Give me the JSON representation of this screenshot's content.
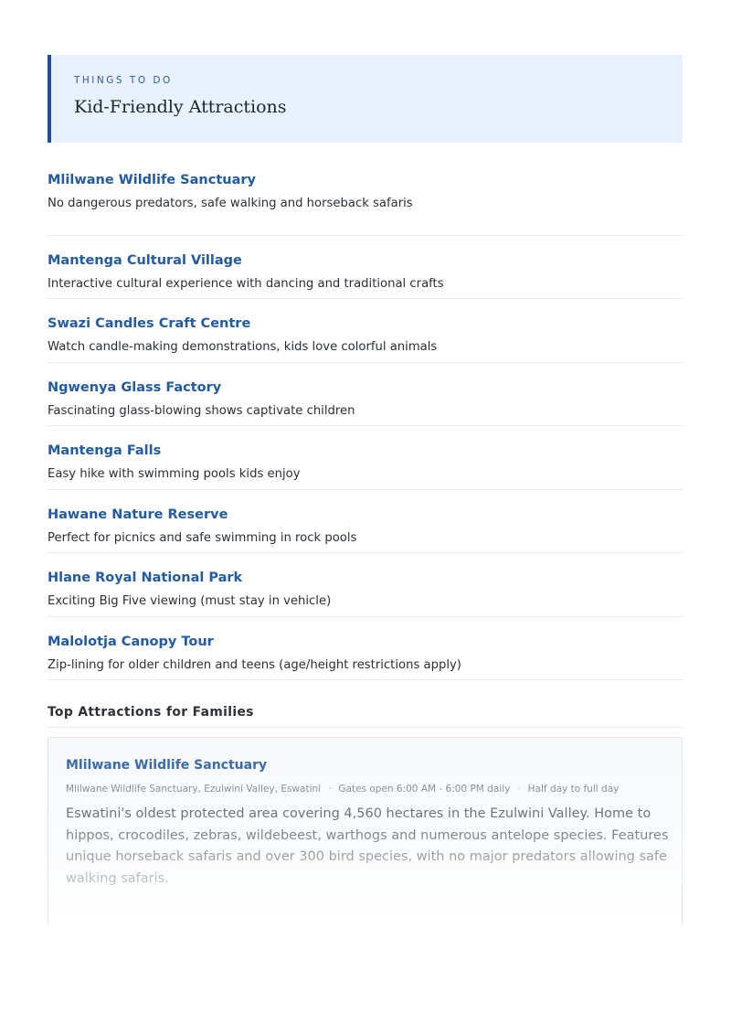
{
  "header": {
    "eyebrow": "THINGS TO DO",
    "title": "Kid-Friendly Attractions"
  },
  "attractions": [
    {
      "name": "Mlilwane Wildlife Sanctuary",
      "desc": "No dangerous predators, safe walking and horseback safaris"
    },
    {
      "name": "Mantenga Cultural Village",
      "desc": "Interactive cultural experience with dancing and traditional crafts"
    },
    {
      "name": "Swazi Candles Craft Centre",
      "desc": "Watch candle-making demonstrations, kids love colorful animals"
    },
    {
      "name": "Ngwenya Glass Factory",
      "desc": "Fascinating glass-blowing shows captivate children"
    },
    {
      "name": "Mantenga Falls",
      "desc": "Easy hike with swimming pools kids enjoy"
    },
    {
      "name": "Hawane Nature Reserve",
      "desc": "Perfect for picnics and safe swimming in rock pools"
    },
    {
      "name": "Hlane Royal National Park",
      "desc": "Exciting Big Five viewing (must stay in vehicle)"
    },
    {
      "name": "Malolotja Canopy Tour",
      "desc": "Zip-lining for older children and teens (age/height restrictions apply)"
    }
  ],
  "top_section": {
    "title": "Top Attractions for Families",
    "card": {
      "name": "Mlilwane Wildlife Sanctuary",
      "location": "Mlilwane Wildlife Sanctuary, Ezulwini Valley, Eswatini",
      "hours": "Gates open 6:00 AM - 6:00 PM daily",
      "duration": "Half day to full day",
      "separator": "·",
      "description": "Eswatini's oldest protected area covering 4,560 hectares in the Ezulwini Valley. Home to hippos, crocodiles, zebras, wildebeest, warthogs and numerous antelope species. Features unique horseback safaris and over 300 bird species, with no major predators allowing safe walking safaris."
    }
  }
}
